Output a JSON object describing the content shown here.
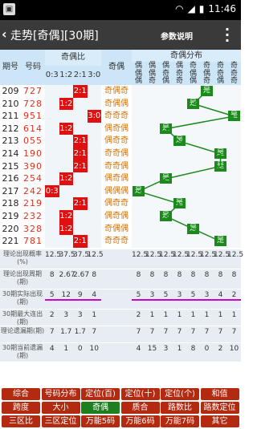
{
  "status": {
    "time": "11:46"
  },
  "appbar": {
    "title": "走势[奇偶][30期]",
    "params": "参数说明"
  },
  "header": {
    "issue": "期号",
    "code": "号码",
    "ratio": "奇偶比",
    "ratio_cols": [
      "0:3",
      "1:2",
      "2:1",
      "3:0"
    ],
    "pattern": "奇偶",
    "dist": "奇偶分布",
    "dist_cols": [
      "偶\n偶\n偶",
      "偶\n偶\n奇",
      "偶\n奇\n偶",
      "偶\n奇\n奇",
      "奇\n偶\n偶",
      "奇\n偶\n奇",
      "奇\n奇\n偶",
      "奇\n奇\n奇"
    ]
  },
  "rows": [
    {
      "issue": "209",
      "code": "727",
      "ratio": "2:1",
      "ratio_idx": 2,
      "pattern": "奇偶奇",
      "dist_idx": 5
    },
    {
      "issue": "210",
      "code": "728",
      "ratio": "1:2",
      "ratio_idx": 1,
      "pattern": "奇偶偶",
      "dist_idx": 4
    },
    {
      "issue": "211",
      "code": "951",
      "ratio": "3:0",
      "ratio_idx": 3,
      "pattern": "奇奇奇",
      "dist_idx": 7
    },
    {
      "issue": "212",
      "code": "614",
      "ratio": "1:2",
      "ratio_idx": 1,
      "pattern": "偶奇偶",
      "dist_idx": 2
    },
    {
      "issue": "213",
      "code": "055",
      "ratio": "2:1",
      "ratio_idx": 2,
      "pattern": "偶奇奇",
      "dist_idx": 3
    },
    {
      "issue": "214",
      "code": "190",
      "ratio": "2:1",
      "ratio_idx": 2,
      "pattern": "奇奇偶",
      "dist_idx": 6
    },
    {
      "issue": "215",
      "code": "390",
      "ratio": "2:1",
      "ratio_idx": 2,
      "pattern": "奇奇偶",
      "dist_idx": 6
    },
    {
      "issue": "216",
      "code": "254",
      "ratio": "1:2",
      "ratio_idx": 1,
      "pattern": "偶奇偶",
      "dist_idx": 2
    },
    {
      "issue": "217",
      "code": "242",
      "ratio": "0:3",
      "ratio_idx": 0,
      "pattern": "偶偶偶",
      "dist_idx": 0
    },
    {
      "issue": "218",
      "code": "219",
      "ratio": "2:1",
      "ratio_idx": 2,
      "pattern": "偶奇奇",
      "dist_idx": 3
    },
    {
      "issue": "219",
      "code": "232",
      "ratio": "1:2",
      "ratio_idx": 1,
      "pattern": "偶奇偶",
      "dist_idx": 2
    },
    {
      "issue": "220",
      "code": "328",
      "ratio": "1:2",
      "ratio_idx": 1,
      "pattern": "奇偶偶",
      "dist_idx": 4
    },
    {
      "issue": "221",
      "code": "781",
      "ratio": "2:1",
      "ratio_idx": 2,
      "pattern": "奇奇奇",
      "dist_idx": 6
    }
  ],
  "yes_label": "是",
  "stats": [
    {
      "label": "理论出现概率(%)",
      "ratio": [
        "12.5",
        "37.5",
        "37.5",
        "12.5"
      ],
      "dist": [
        "12.5",
        "12.5",
        "12.5",
        "12.5",
        "12.5",
        "12.5",
        "12.5",
        "12.5"
      ]
    },
    {
      "label": "理论出现周期(期)",
      "ratio": [
        "8",
        "2.67",
        "2.67",
        "8"
      ],
      "dist": [
        "8",
        "8",
        "8",
        "8",
        "8",
        "8",
        "8",
        "8"
      ]
    },
    {
      "label": "30期实际出现(期)",
      "ratio": [
        "5",
        "12",
        "9",
        "4"
      ],
      "dist": [
        "5",
        "3",
        "5",
        "3",
        "5",
        "3",
        "4",
        "2"
      ]
    },
    {
      "label": "30期最大连出(期)",
      "ratio": [
        "2",
        "3",
        "3",
        "1"
      ],
      "dist": [
        "2",
        "1",
        "1",
        "1",
        "1",
        "1",
        "1",
        "1"
      ]
    },
    {
      "label": "理论遗漏期(期)",
      "ratio": [
        "7",
        "1.7",
        "1.7",
        "7"
      ],
      "dist": [
        "7",
        "7",
        "7",
        "7",
        "7",
        "7",
        "7",
        "7"
      ]
    },
    {
      "label": "30期当前遗漏(期)",
      "ratio": [
        "4",
        "1",
        "0",
        "10"
      ],
      "dist": [
        "4",
        "15",
        "3",
        "1",
        "8",
        "0",
        "2",
        "10"
      ]
    }
  ],
  "tabs": [
    [
      "综合",
      "号码分布",
      "定位(百)",
      "定位(十)",
      "定位(个)",
      "和值"
    ],
    [
      "跨度",
      "大小",
      "奇偶",
      "质合",
      "路数比",
      "路数定位"
    ],
    [
      "三区比",
      "三区定位",
      "万能5码",
      "万能6码",
      "万能7码",
      "其它"
    ]
  ],
  "selected_tab": "奇偶"
}
